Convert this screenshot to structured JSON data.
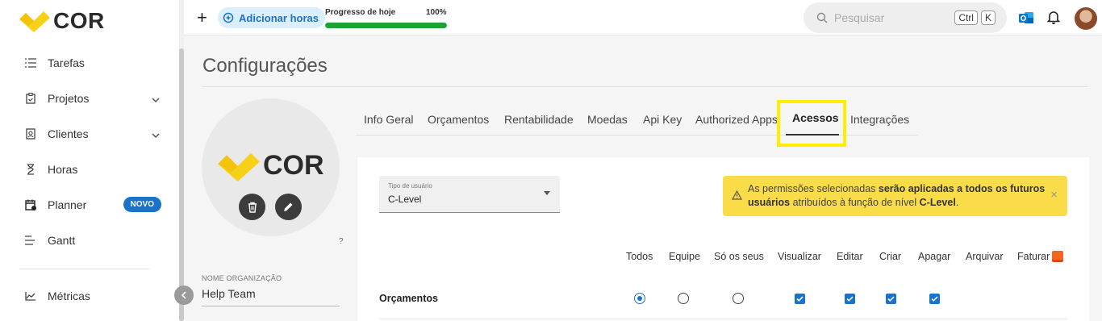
{
  "app": {
    "logo_text": "COR",
    "brand_color": "#f7d117"
  },
  "sidebar": {
    "items": [
      {
        "label": "Tarefas",
        "icon": "checklist-icon"
      },
      {
        "label": "Projetos",
        "icon": "clipboard-icon"
      },
      {
        "label": "Clientes",
        "icon": "contact-card-icon"
      },
      {
        "label": "Horas",
        "icon": "hourglass-icon"
      },
      {
        "label": "Planner",
        "icon": "calendar-icon",
        "badge": "NOVO"
      },
      {
        "label": "Gantt",
        "icon": "gantt-icon"
      },
      {
        "label": "Métricas",
        "icon": "chart-line-icon"
      }
    ]
  },
  "topbar": {
    "add_hours_label": "Adicionar horas",
    "progress_label": "Progresso de hoje",
    "progress_value_text": "100%",
    "progress_fraction": 1.0,
    "search_placeholder": "Pesquisar",
    "shortcut_keys": [
      "Ctrl",
      "K"
    ]
  },
  "page": {
    "title": "Configurações"
  },
  "organization": {
    "logo_text": "COR",
    "help_mark": "?",
    "name_label": "NOME ORGANIZAÇÃO",
    "name_value": "Help Team"
  },
  "tabs": [
    {
      "label": "Info Geral"
    },
    {
      "label": "Orçamentos"
    },
    {
      "label": "Rentabilidade"
    },
    {
      "label": "Moedas"
    },
    {
      "label": "Api Key"
    },
    {
      "label": "Authorized Apps"
    },
    {
      "label": "Acessos",
      "active": true
    },
    {
      "label": "Integrações"
    }
  ],
  "user_type": {
    "label": "Tipo de usuário",
    "value": "C-Level"
  },
  "alert": {
    "text_1": "As permissões selecionadas ",
    "bold_1": "serão aplicadas a todos os futuros usuários",
    "text_2": " atribuídos à função de nível ",
    "bold_2": "C-Level",
    "text_3": ".",
    "close": "×"
  },
  "permissions": {
    "columns": [
      "Todos",
      "Equipe",
      "Só os seus",
      "Visualizar",
      "Editar",
      "Criar",
      "Apagar",
      "Arquivar",
      "Faturar"
    ],
    "rows": [
      {
        "label": "Orçamentos",
        "scope": "Todos",
        "visualizar": true,
        "editar": true,
        "criar": true,
        "apagar": true
      }
    ]
  },
  "colors": {
    "accent": "#1a73c8",
    "progress": "#1aa433",
    "alert_bg": "#f9dc48",
    "highlight": "#ffee00"
  }
}
